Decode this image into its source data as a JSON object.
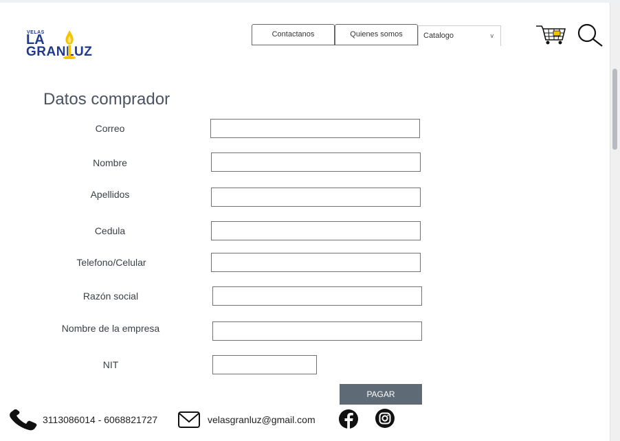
{
  "brand": {
    "logo_top": "VELAS",
    "logo_line1": "LA",
    "logo_line2": "GRANLUZ"
  },
  "nav": {
    "contact_label": "Contactanos",
    "about_label": "Quienes somos",
    "catalog_selected": "Catalogo",
    "catalog_arrow": "v"
  },
  "icons": {
    "cart": "shopping-cart-icon",
    "search": "search-icon",
    "phone": "phone-icon",
    "mail": "mail-icon",
    "facebook": "facebook-icon",
    "instagram": "instagram-icon"
  },
  "form": {
    "title": "Datos comprador",
    "fields": [
      {
        "label": "Correo",
        "value": ""
      },
      {
        "label": "Nombre",
        "value": ""
      },
      {
        "label": "Apellidos",
        "value": ""
      },
      {
        "label": "Cedula",
        "value": ""
      },
      {
        "label": "Telefono/Celular",
        "value": ""
      },
      {
        "label": "Razón social",
        "value": ""
      },
      {
        "label": "Nombre de la empresa",
        "value": ""
      },
      {
        "label": "NIT",
        "value": ""
      }
    ],
    "submit_label": "PAGAR"
  },
  "footer": {
    "phone": "3113086014 - 6068821727",
    "email": "velasgranluz@gmail.com"
  },
  "colors": {
    "brand_blue": "#1f3a8c",
    "flame_yellow": "#f5c400",
    "button_gray": "#5f6a77"
  }
}
